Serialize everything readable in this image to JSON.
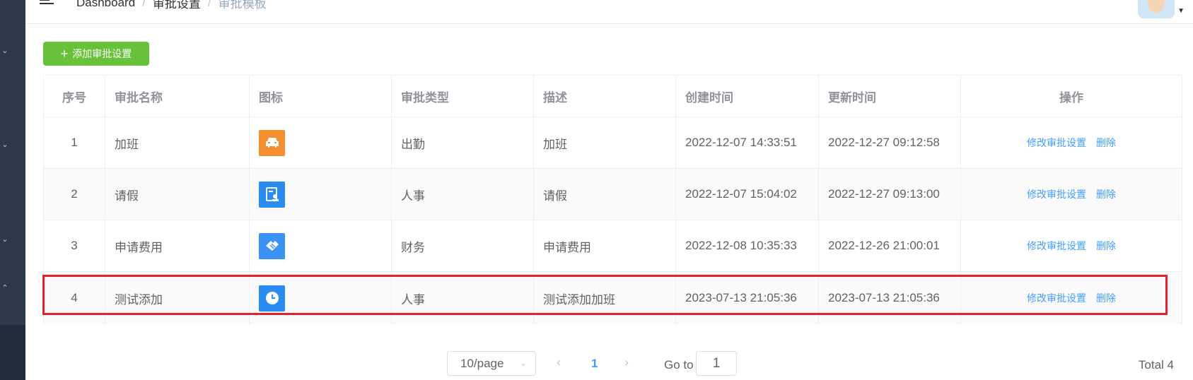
{
  "breadcrumb": [
    "Dashboard",
    "审批设置",
    "审批模板"
  ],
  "add_button_label": "添加审批设置",
  "table": {
    "headers": [
      "序号",
      "审批名称",
      "图标",
      "审批类型",
      "描述",
      "创建时间",
      "更新时间",
      "操作"
    ],
    "rows": [
      {
        "index": "1",
        "name": "加班",
        "icon": "car-icon",
        "icon_color": "#f58e2e",
        "type": "出勤",
        "desc": "加班",
        "created": "2022-12-07 14:33:51",
        "updated": "2022-12-27 09:12:58",
        "edit": "修改审批设置",
        "delete": "删除"
      },
      {
        "index": "2",
        "name": "请假",
        "icon": "leave-form-icon",
        "icon_color": "#2a8bf2",
        "type": "人事",
        "desc": "请假",
        "created": "2022-12-07 15:04:02",
        "updated": "2022-12-27 09:13:00",
        "edit": "修改审批设置",
        "delete": "删除"
      },
      {
        "index": "3",
        "name": "申请费用",
        "icon": "handshake-icon",
        "icon_color": "#3a92f2",
        "type": "财务",
        "desc": "申请费用",
        "created": "2022-12-08 10:35:33",
        "updated": "2022-12-26 21:00:01",
        "edit": "修改审批设置",
        "delete": "删除"
      },
      {
        "index": "4",
        "name": "测试添加",
        "icon": "clock-icon",
        "icon_color": "#2a8bf2",
        "type": "人事",
        "desc": "测试添加加班",
        "created": "2023-07-13 21:05:36",
        "updated": "2023-07-13 21:05:36",
        "edit": "修改审批设置",
        "delete": "删除"
      }
    ]
  },
  "pagination": {
    "page_size": "10/page",
    "current_page": "1",
    "goto_label": "Go to",
    "goto_value": "1",
    "total": "Total 4"
  },
  "colors": {
    "highlight": "#e8202a",
    "primary": "#409eff",
    "success": "#67c23a"
  }
}
